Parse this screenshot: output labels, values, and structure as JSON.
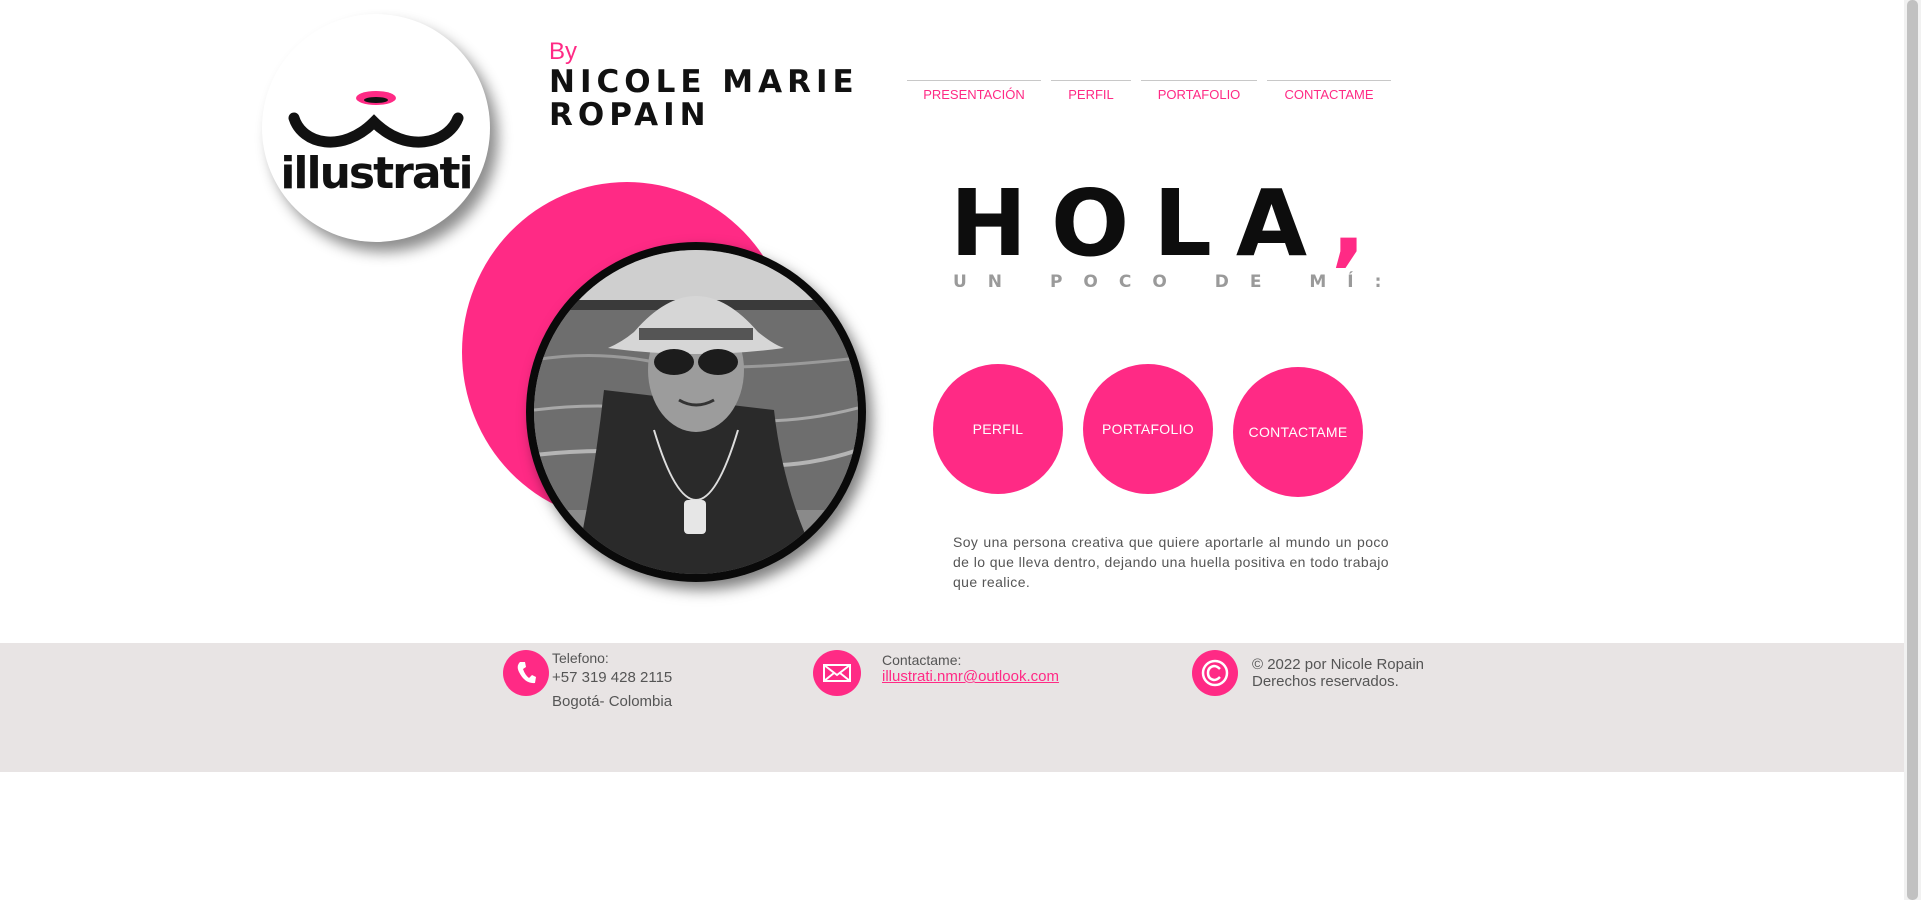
{
  "logo": {
    "text": "illustrati",
    "icon": "cat-lips-logo"
  },
  "header": {
    "by": "By",
    "name_line1": "NICOLE MARIE",
    "name_line2": "ROPAIN"
  },
  "nav": {
    "items": [
      {
        "label": "PRESENTACIÓN"
      },
      {
        "label": "PERFIL"
      },
      {
        "label": "PORTAFOLIO"
      },
      {
        "label": "CONTACTAME"
      }
    ]
  },
  "hero": {
    "greeting": "HOLA",
    "comma": ",",
    "subtitle": "UN POCO DE MÍ:",
    "buttons": [
      {
        "label": "PERFIL"
      },
      {
        "label": "PORTAFOLIO"
      },
      {
        "label": "CONTACTAME"
      }
    ],
    "bio": "Soy una persona creativa que quiere aportarle al mundo un poco de lo que lleva dentro, dejando una huella positiva en todo trabajo que realice."
  },
  "footer": {
    "phone": {
      "label": "Telefono:",
      "number": "+57 319 428 2115",
      "location": "Bogotá- Colombia",
      "icon": "phone-icon"
    },
    "contact": {
      "label": "Contactame:",
      "email": "illustrati.nmr@outlook.com",
      "icon": "mail-icon"
    },
    "copyright": {
      "line1": "© 2022 por Nicole Ropain",
      "line2": "Derechos reservados.",
      "icon": "copyright-icon"
    }
  },
  "colors": {
    "accent": "#ff2a85",
    "footer_bg": "#e8e4e4",
    "text": "#111111"
  }
}
